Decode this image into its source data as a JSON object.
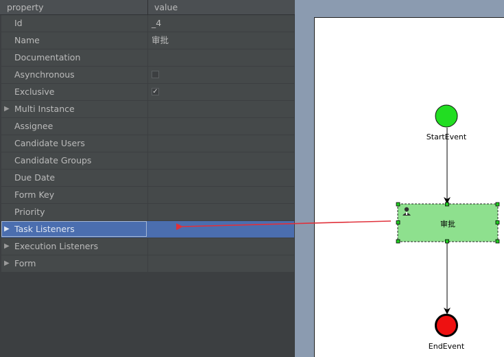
{
  "properties_panel": {
    "header": {
      "property": "property",
      "value": "value"
    },
    "rows": [
      {
        "label": "Id",
        "value": "_4"
      },
      {
        "label": "Name",
        "value": "审批"
      },
      {
        "label": "Documentation",
        "value": ""
      },
      {
        "label": "Asynchronous",
        "checked": false
      },
      {
        "label": "Exclusive",
        "checked": true
      },
      {
        "label": "Multi Instance",
        "expandable": true
      },
      {
        "label": "Assignee",
        "value": ""
      },
      {
        "label": "Candidate Users",
        "value": ""
      },
      {
        "label": "Candidate Groups",
        "value": ""
      },
      {
        "label": "Due Date",
        "value": ""
      },
      {
        "label": "Form Key",
        "value": ""
      },
      {
        "label": "Priority",
        "value": ""
      },
      {
        "label": "Task Listeners",
        "expandable": true,
        "selected": true
      },
      {
        "label": "Execution Listeners",
        "expandable": true
      },
      {
        "label": "Form",
        "expandable": true
      }
    ],
    "checkmark_glyph": "✓",
    "expand_glyph": "▶"
  },
  "diagram": {
    "start_event": {
      "label": "StartEvent",
      "color": "#22dd22"
    },
    "user_task": {
      "label": "审批",
      "color": "#8ee08e",
      "icon": "user-icon"
    },
    "end_event": {
      "label": "EndEvent",
      "color": "#ee1111"
    },
    "annotation_arrow_color": "#e0303a"
  }
}
